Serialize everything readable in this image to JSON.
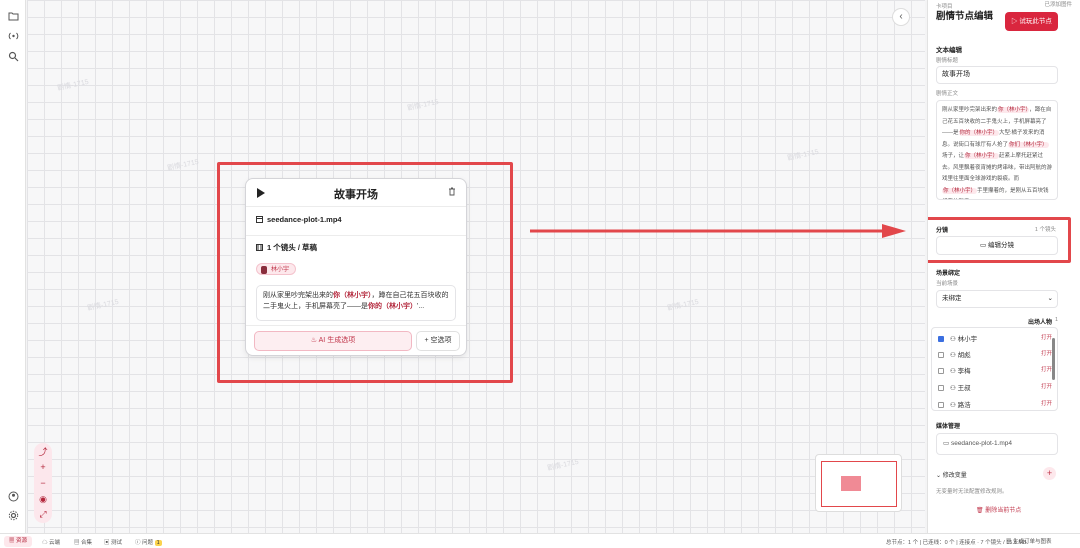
{
  "rail": {
    "icons": [
      "folder-icon",
      "broadcast-icon",
      "search-icon",
      "user-icon",
      "settings-icon"
    ]
  },
  "canvas": {
    "watermark": "剧情-1715"
  },
  "node": {
    "title": "故事开场",
    "file": "seedance-plot-1.mp4",
    "shots": "1 个镜头 / 草稿",
    "character_tag": "林小宇",
    "story_parts": [
      "刚从家里吵完架出来的",
      "你（林小宇）",
      "，蹲在自己花五百块收的二手鬼火上，手机屏幕亮了——是",
      "你的（林小宇）",
      "'..."
    ],
    "ai_button": "AI 生成选项",
    "empty_option_button": "空选项"
  },
  "zoom": {
    "buttons": [
      "+",
      "−"
    ]
  },
  "panel": {
    "top_small": "卡项目",
    "top_right_small": "已添加图件",
    "title": "剧情节点编辑",
    "try_button": "试玩此节点",
    "section_text": "文本编辑",
    "plot_title_label": "剧情标题",
    "plot_title_value": "故事开场",
    "plot_body_label": "剧情正文",
    "body_parts": [
      "刚从家里吵完架出来的",
      "你（林小宇）",
      "，蹲在自己花五百块收的二手鬼火上，手机屏幕亮了——是",
      "你的（林小宇）",
      "大型:橘子发来的消息。说街口有球厅有人抢了",
      "你们（林小宇）",
      "场子，让",
      "你（林小宇）",
      "赶紧上摩托赶紧过去。风里飘着夜宵摊的烤串味，带出阿航的游戏里往里面全球游戏的裂痕。而",
      "你（林小宇）",
      "手里攥着的，是刚从五百块钱想要的新手。"
    ],
    "storyboard_label": "分镜",
    "storyboard_count": "1 个镜头",
    "edit_storyboard_button": "编辑分镜",
    "scene_label": "场景绑定",
    "current_scene_label": "当前场景",
    "scene_select": "未绑定",
    "cast_label": "出场人物",
    "cast_count": "1",
    "characters": [
      {
        "name": "林小宇",
        "checked": true,
        "action": "打开"
      },
      {
        "name": "胡彪",
        "checked": false,
        "action": "打开"
      },
      {
        "name": "李梅",
        "checked": false,
        "action": "打开"
      },
      {
        "name": "王叔",
        "checked": false,
        "action": "打开"
      },
      {
        "name": "路浩",
        "checked": false,
        "action": "打开"
      }
    ],
    "media_label": "媒体管理",
    "media_file": "seedance-plot-1.mp4",
    "settings_label": "修改变量",
    "settings_note": "无变量时无法配置修改规则。",
    "delete_button": "删除当前节点"
  },
  "status": {
    "items": [
      "资源",
      "云端",
      "合集",
      "测试",
      "问题"
    ],
    "problem_count": "1",
    "right_text": "总节点：1 个 | 已连线：0 个 | 连接点 · 7 个镜头 / 15.6 MB",
    "export_text": "生成订单与图表"
  },
  "colors": {
    "accent": "#d9263e",
    "highlight": "#e2474b",
    "pink_bg": "#fde8ec"
  }
}
